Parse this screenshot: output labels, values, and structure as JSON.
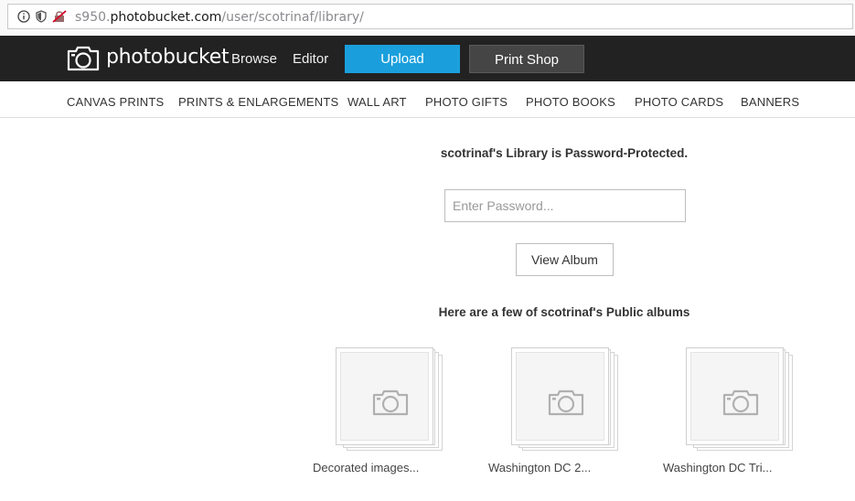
{
  "browser": {
    "url_prefix": "s950.",
    "url_host": "photobucket.com",
    "url_path": "/user/scotrinaf/library/"
  },
  "header": {
    "logo_text": "photobucket",
    "nav": [
      "Browse",
      "Editor"
    ],
    "upload_label": "Upload",
    "print_shop_label": "Print Shop"
  },
  "subnav": [
    "CANVAS PRINTS",
    "PRINTS & ENLARGEMENTS",
    "WALL ART",
    "PHOTO GIFTS",
    "PHOTO BOOKS",
    "PHOTO CARDS",
    "BANNERS"
  ],
  "main": {
    "headline": "scotrinaf's Library is Password-Protected.",
    "password_placeholder": "Enter Password...",
    "view_album_label": "View Album",
    "public_heading": "Here are a few of scotrinaf's Public albums",
    "albums": [
      {
        "title": "Decorated images..."
      },
      {
        "title": "Washington DC 2..."
      },
      {
        "title": "Washington DC Tri..."
      }
    ]
  },
  "colors": {
    "nav_bg": "#222222",
    "upload_bg": "#1a9fdc",
    "print_shop_bg": "#454545"
  }
}
